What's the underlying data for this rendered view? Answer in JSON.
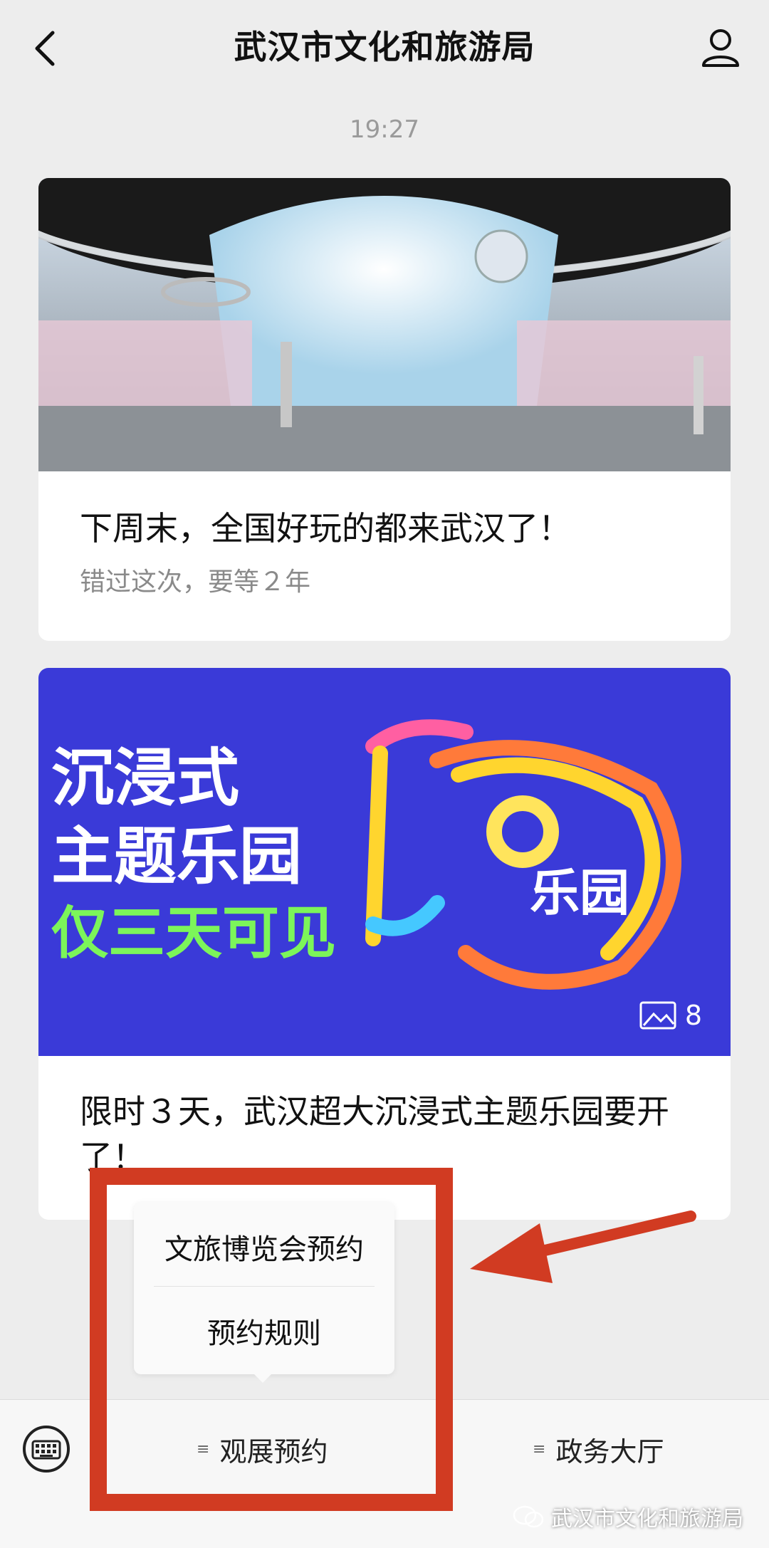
{
  "header": {
    "title": "武汉市文化和旅游局"
  },
  "chat": {
    "timestamp": "19:27"
  },
  "articles": [
    {
      "title": "下周末，全国好玩的都来武汉了！",
      "subtitle": "错过这次，要等２年"
    },
    {
      "title": "限时３天，武汉超大沉浸式主题乐园要开了！",
      "image_text": [
        "沉浸式",
        "主题乐园",
        "仅三天可见"
      ],
      "image_logo": "乐园",
      "image_count": "8"
    }
  ],
  "popup_menu": {
    "items": [
      "文旅博览会预约",
      "预约规则"
    ]
  },
  "bottom_menu": {
    "items": [
      "观展预约",
      "政务大厅"
    ]
  },
  "watermark": "武汉市文化和旅游局",
  "colors": {
    "highlight": "#d13b22",
    "card2_bg": "#3a3ad8",
    "background": "#ededed"
  }
}
